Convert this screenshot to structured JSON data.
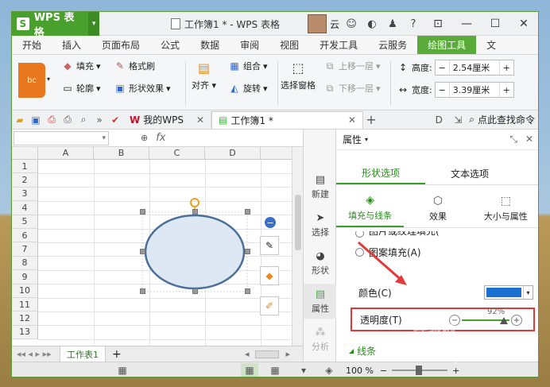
{
  "title_bar": {
    "app_name": "WPS 表格",
    "doc_title": "工作簿1 * - WPS 表格",
    "user_label": "云"
  },
  "menu_tabs": [
    "开始",
    "插入",
    "页面布局",
    "公式",
    "数据",
    "审阅",
    "视图",
    "开发工具",
    "云服务",
    "绘图工具",
    "文"
  ],
  "ribbon": {
    "shape_style_label": "bc",
    "fill": "填充",
    "format_brush": "格式刷",
    "outline": "轮廓",
    "shape_effects": "形状效果",
    "align": "对齐",
    "group": "组合",
    "rotate": "旋转",
    "selection_pane": "选择窗格",
    "bring_forward": "上移一层",
    "send_backward": "下移一层",
    "height_label": "高度:",
    "height_value": "2.54厘米",
    "width_label": "宽度:",
    "width_value": "3.39厘米"
  },
  "toolbar2": {
    "tab_mywps": "我的WPS",
    "tab_workbook": "工作簿1 *",
    "find_command": "点此查找命令"
  },
  "formula_bar": {
    "fx": "fx"
  },
  "sheet": {
    "columns": [
      "A",
      "B",
      "C",
      "D"
    ],
    "rows": [
      "1",
      "2",
      "3",
      "4",
      "5",
      "6",
      "7",
      "8",
      "9",
      "10",
      "11",
      "12",
      "13"
    ],
    "sheet_tab": "工作表1"
  },
  "side_toolbar": [
    "新建",
    "选择",
    "形状",
    "属性",
    "分析"
  ],
  "panel": {
    "title": "属性",
    "tab_shape": "形状选项",
    "tab_text": "文本选项",
    "sub_fill_line": "填充与线条",
    "sub_effects": "效果",
    "sub_size": "大小与属性",
    "partial_option": "图片或纹理填充(",
    "pattern_fill": "图案填充(A)",
    "color_label": "颜色(C)",
    "transparency_label": "透明度(T)",
    "transparency_value": "92%",
    "line_section": "线条"
  },
  "status_bar": {
    "zoom": "100 %"
  },
  "watermark": {
    "text": "经验啦",
    "url": "zhinan.sogou.com"
  },
  "colors": {
    "accent_green": "#5aaa3a",
    "fill_blue": "#1b6fd1",
    "highlight_red": "#e23a3a",
    "ellipse_fill": "#dde8f4",
    "ellipse_stroke": "#4a6f9a"
  }
}
